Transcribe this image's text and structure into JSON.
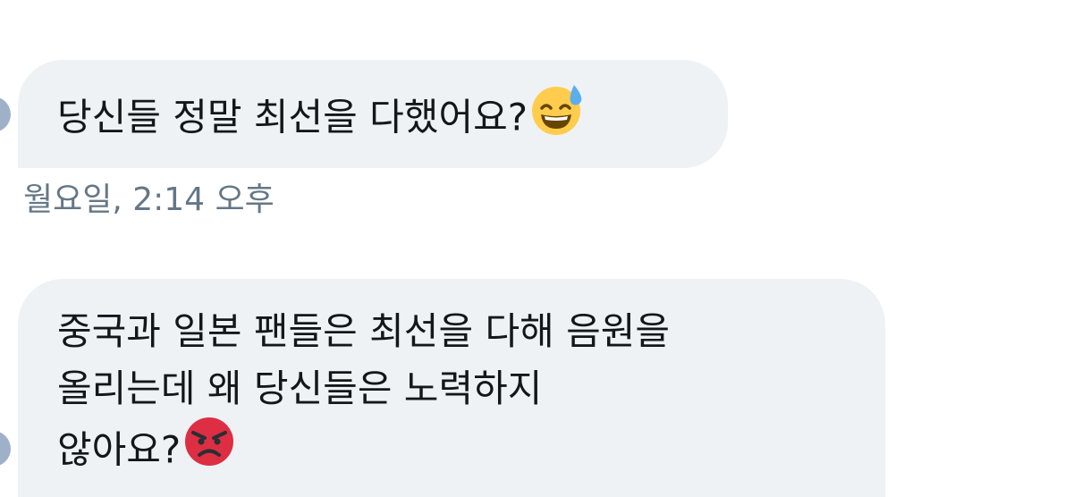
{
  "messages": [
    {
      "lines": [
        "당신들 정말 최선을 다했어요?"
      ],
      "emoji": "grinning-sweat-emoji",
      "timestamp": "월요일, 2:14 오후"
    },
    {
      "lines": [
        "중국과 일본 팬들은 최선을 다해 음원을",
        "올리는데 왜 당신들은 노력하지",
        "않아요?"
      ],
      "emoji": "angry-face-emoji"
    }
  ],
  "colors": {
    "bubble": "#eff2f5",
    "text": "#14171a",
    "timestamp": "#657786",
    "avatar": "#9fb0c9",
    "emoji_yellow": "#ffcc4d",
    "emoji_red": "#dd2e44",
    "sweat_blue": "#5dadec"
  }
}
